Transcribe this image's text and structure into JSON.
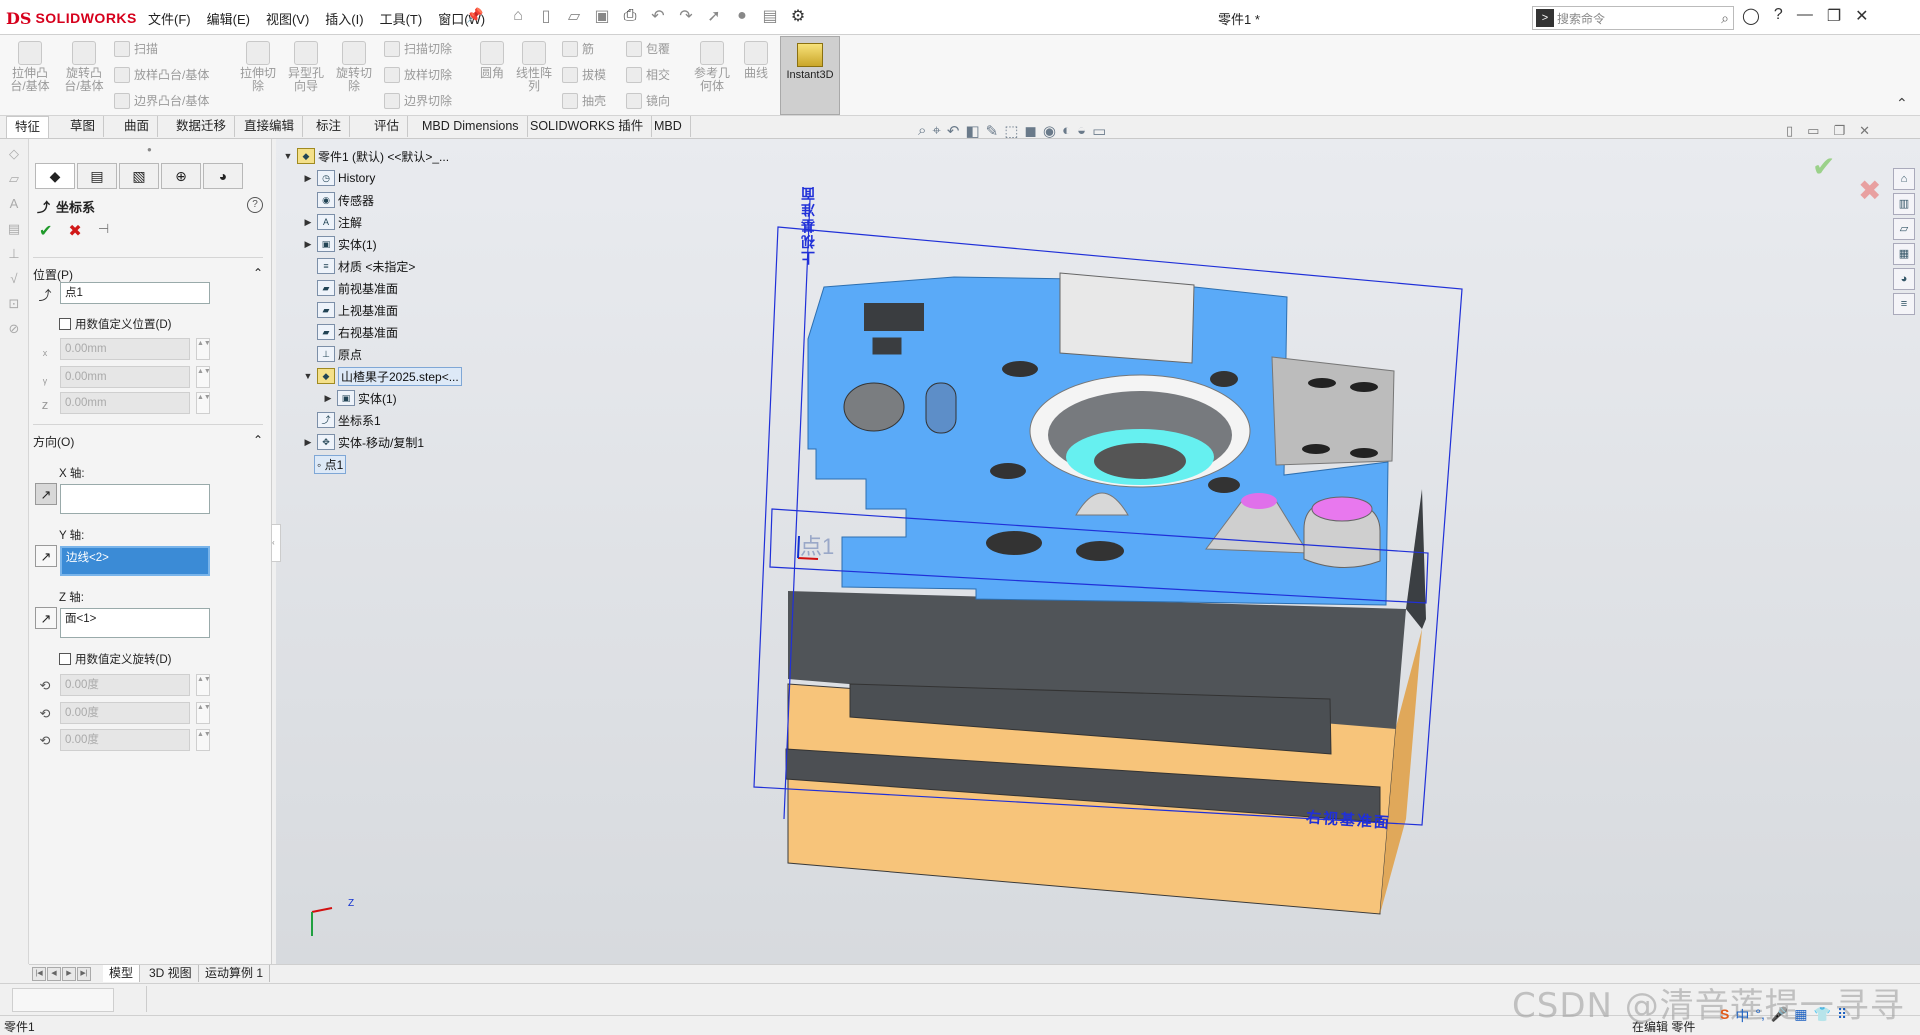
{
  "app": {
    "logo_mark": "DS",
    "logo_text": "SOLIDWORKS",
    "doc_title": "零件1 *",
    "menus": [
      "文件(F)",
      "编辑(E)",
      "视图(V)",
      "插入(I)",
      "工具(T)",
      "窗口(W)"
    ],
    "search_placeholder": "搜索命令"
  },
  "commands": {
    "extrude_boss": "拉伸凸\n台/基体",
    "revolve_boss": "旋转凸\n台/基体",
    "sweep": "扫描",
    "loft": "放样凸台/基体",
    "boundary_boss": "边界凸台/基体",
    "extrude_cut": "拉伸切\n除",
    "hole_wizard": "异型孔\n向导",
    "revolve_cut": "旋转切\n除",
    "sweep_cut": "扫描切除",
    "loft_cut": "放样切除",
    "boundary_cut": "边界切除",
    "fillet": "圆角",
    "linear_pattern": "线性阵\n列",
    "rib": "筋",
    "draft": "拔模",
    "shell": "抽壳",
    "wrap": "包覆",
    "intersect": "相交",
    "mirror": "镜向",
    "ref_geometry": "参考几\n何体",
    "curves": "曲线",
    "instant3d": "Instant3D"
  },
  "tabs": [
    "特征",
    "草图",
    "曲面",
    "数据迁移",
    "直接编辑",
    "标注",
    "评估",
    "MBD Dimensions",
    "SOLIDWORKS 插件",
    "MBD"
  ],
  "property_manager": {
    "title": "坐标系",
    "position_section": "位置(P)",
    "point_value": "点1",
    "use_numeric_position": "用数值定义位置(D)",
    "x_value": "0.00mm",
    "y_value": "0.00mm",
    "z_value": "0.00mm",
    "direction_section": "方向(O)",
    "x_axis_label": "X 轴:",
    "x_axis_value": "",
    "y_axis_label": "Y 轴:",
    "y_axis_value": "边线<2>",
    "z_axis_label": "Z 轴:",
    "z_axis_value": "面<1>",
    "use_numeric_rotation": "用数值定义旋转(D)",
    "rot_x": "0.00度",
    "rot_y": "0.00度",
    "rot_z": "0.00度"
  },
  "feature_tree": {
    "root": "零件1 (默认) <<默认>_...",
    "items": [
      "History",
      "传感器",
      "注解",
      "实体(1)",
      "材质 <未指定>",
      "前视基准面",
      "上视基准面",
      "右视基准面",
      "原点",
      "山楂果子2025.step<...",
      "实体(1)",
      "坐标系1",
      "实体-移动/复制1",
      "点1"
    ]
  },
  "viewport": {
    "top_plane_label": "上视基准面",
    "right_plane_label": "右视基准面",
    "point_label": "点1",
    "triad_z": "Z",
    "colors": {
      "top_face": "#5aaaf8",
      "side": "#505458",
      "base": "#f7c47a",
      "plane": "#2030d8"
    }
  },
  "bottom_tabs": [
    "模型",
    "3D 视图",
    "运动算例 1"
  ],
  "status": {
    "left": "零件1",
    "right": "在编辑 零件"
  },
  "watermark": "CSDN @清音莲提一寻寻",
  "ime": [
    "中",
    "°,",
    "🎤",
    "▦",
    "👕",
    "⠿"
  ]
}
